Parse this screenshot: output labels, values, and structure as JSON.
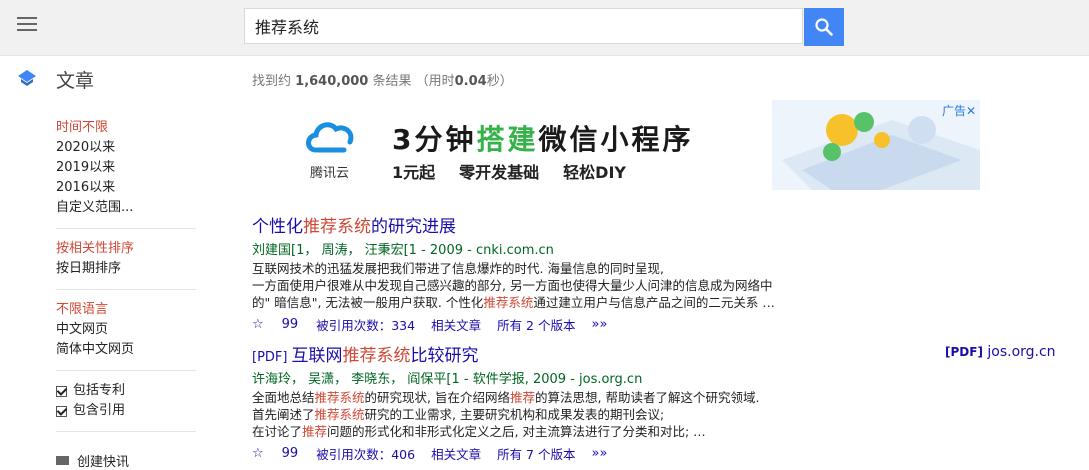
{
  "search": {
    "query": "推荐系统"
  },
  "app": {
    "title": "文章"
  },
  "stats": {
    "prefix": "找到约",
    "count": "1,640,000",
    "suffix": "条结果 （用时",
    "time": "0.04",
    "unit": "秒）"
  },
  "sidebar": {
    "time_filters": [
      "时间不限",
      "2020以来",
      "2019以来",
      "2016以来",
      "自定义范围..."
    ],
    "sort": [
      "按相关性排序",
      "按日期排序"
    ],
    "lang": [
      "不限语言",
      "中文网页",
      "简体中文网页"
    ],
    "checks": [
      "包括专利",
      "包含引用"
    ],
    "alert": "创建快讯"
  },
  "ad": {
    "logo_text": "腾讯云",
    "headline_a": "3分钟",
    "headline_b": "搭建",
    "headline_c": "微信小程序",
    "sub": [
      "1元起",
      "零开发基础",
      "轻松DIY"
    ],
    "label": "广告✕"
  },
  "results": [
    {
      "title_a": "个性化",
      "title_hl": "推荐系统",
      "title_b": "的研究进展",
      "authors": "刘建国[1，  周涛，  汪秉宏[1 - 2009 - cnki.com.cn",
      "snippet_1": "互联网技术的迅猛发展把我们带进了信息爆炸的时代. 海量信息的同时呈现,",
      "snippet_2": "一方面使用户很难从中发现自己感兴趣的部分, 另一方面也使得大量少人问津的信息成为网络中",
      "snippet_3a": "的\" 暗信息\", 无法被一般用户获取. 个性化",
      "snippet_3hl": "推荐系统",
      "snippet_3b": "通过建立用户与信息产品之间的二元关系 …",
      "cited": "被引用次数：334",
      "related": "相关文章",
      "versions": "所有 2 个版本"
    },
    {
      "pdf": "[PDF]",
      "title_a": "互联网",
      "title_hl": "推荐系统",
      "title_b": "比较研究",
      "authors": "许海玲，  吴潇，  李晓东，  阎保平[1 - 软件学报, 2009 - jos.org.cn",
      "snippet_1a": "全面地总结",
      "snippet_1hl": "推荐系统",
      "snippet_1b": "的研究现状, 旨在介绍网络",
      "snippet_1hl2": "推荐",
      "snippet_1c": "的算法思想, 帮助读者了解这个研究领域.",
      "snippet_2a": "首先阐述了",
      "snippet_2hl": "推荐系统",
      "snippet_2b": "研究的工业需求, 主要研究机构和成果发表的期刊会议;",
      "snippet_3a": "在讨论了",
      "snippet_3hl": "推荐",
      "snippet_3b": "问题的形式化和非形式化定义之后, 对主流算法进行了分类和对比; …",
      "cited": "被引用次数：406",
      "related": "相关文章",
      "versions": "所有 7 个版本",
      "side_pdf_tag": "[PDF]",
      "side_pdf_host": "jos.org.cn"
    }
  ],
  "icons": {
    "star": "☆",
    "quote": "99",
    "more": "»»"
  },
  "colors": {
    "brand_blue": "#4285f4",
    "link": "#1a0dab",
    "highlight": "#d14836",
    "green": "#006621",
    "ad_accent": "#35b34a"
  }
}
